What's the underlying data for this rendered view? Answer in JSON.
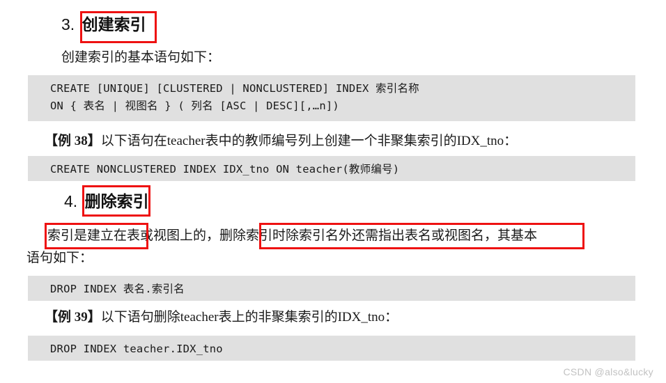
{
  "document": {
    "sections": [
      {
        "number": "3.",
        "title": "创建索引",
        "intro": "创建索引的基本语句如下：",
        "syntax_code": "CREATE [UNIQUE] [CLUSTERED | NONCLUSTERED] INDEX 索引名称\nON { 表名 | 视图名 } ( 列名 [ASC | DESC][,…n])",
        "example_label": "【例 38】",
        "example_text": "以下语句在teacher表中的教师编号列上创建一个非聚集索引的IDX_tno：",
        "example_code": "CREATE NONCLUSTERED INDEX IDX_tno ON teacher(教师编号)"
      },
      {
        "number": "4.",
        "title": "删除索引",
        "para_part1": "索引是建立在表或视图上的",
        "para_sep1": "，",
        "para_part2": "删除索引时除索引名外还需指出表名或视图名",
        "para_part3": "，其基本",
        "para_line2": "语句如下：",
        "syntax_code": "DROP INDEX 表名.索引名",
        "example_label": "【例 39】",
        "example_text": "以下语句删除teacher表上的非聚集索引的IDX_tno：",
        "example_code": "DROP INDEX teacher.IDX_tno"
      }
    ]
  },
  "watermark": {
    "text": "CSDN @also&lucky"
  },
  "colors": {
    "annotation": "#ee1111",
    "code_background": "#e0e0e0",
    "page_background": "#ffffff",
    "watermark": "#c2c2c2"
  }
}
